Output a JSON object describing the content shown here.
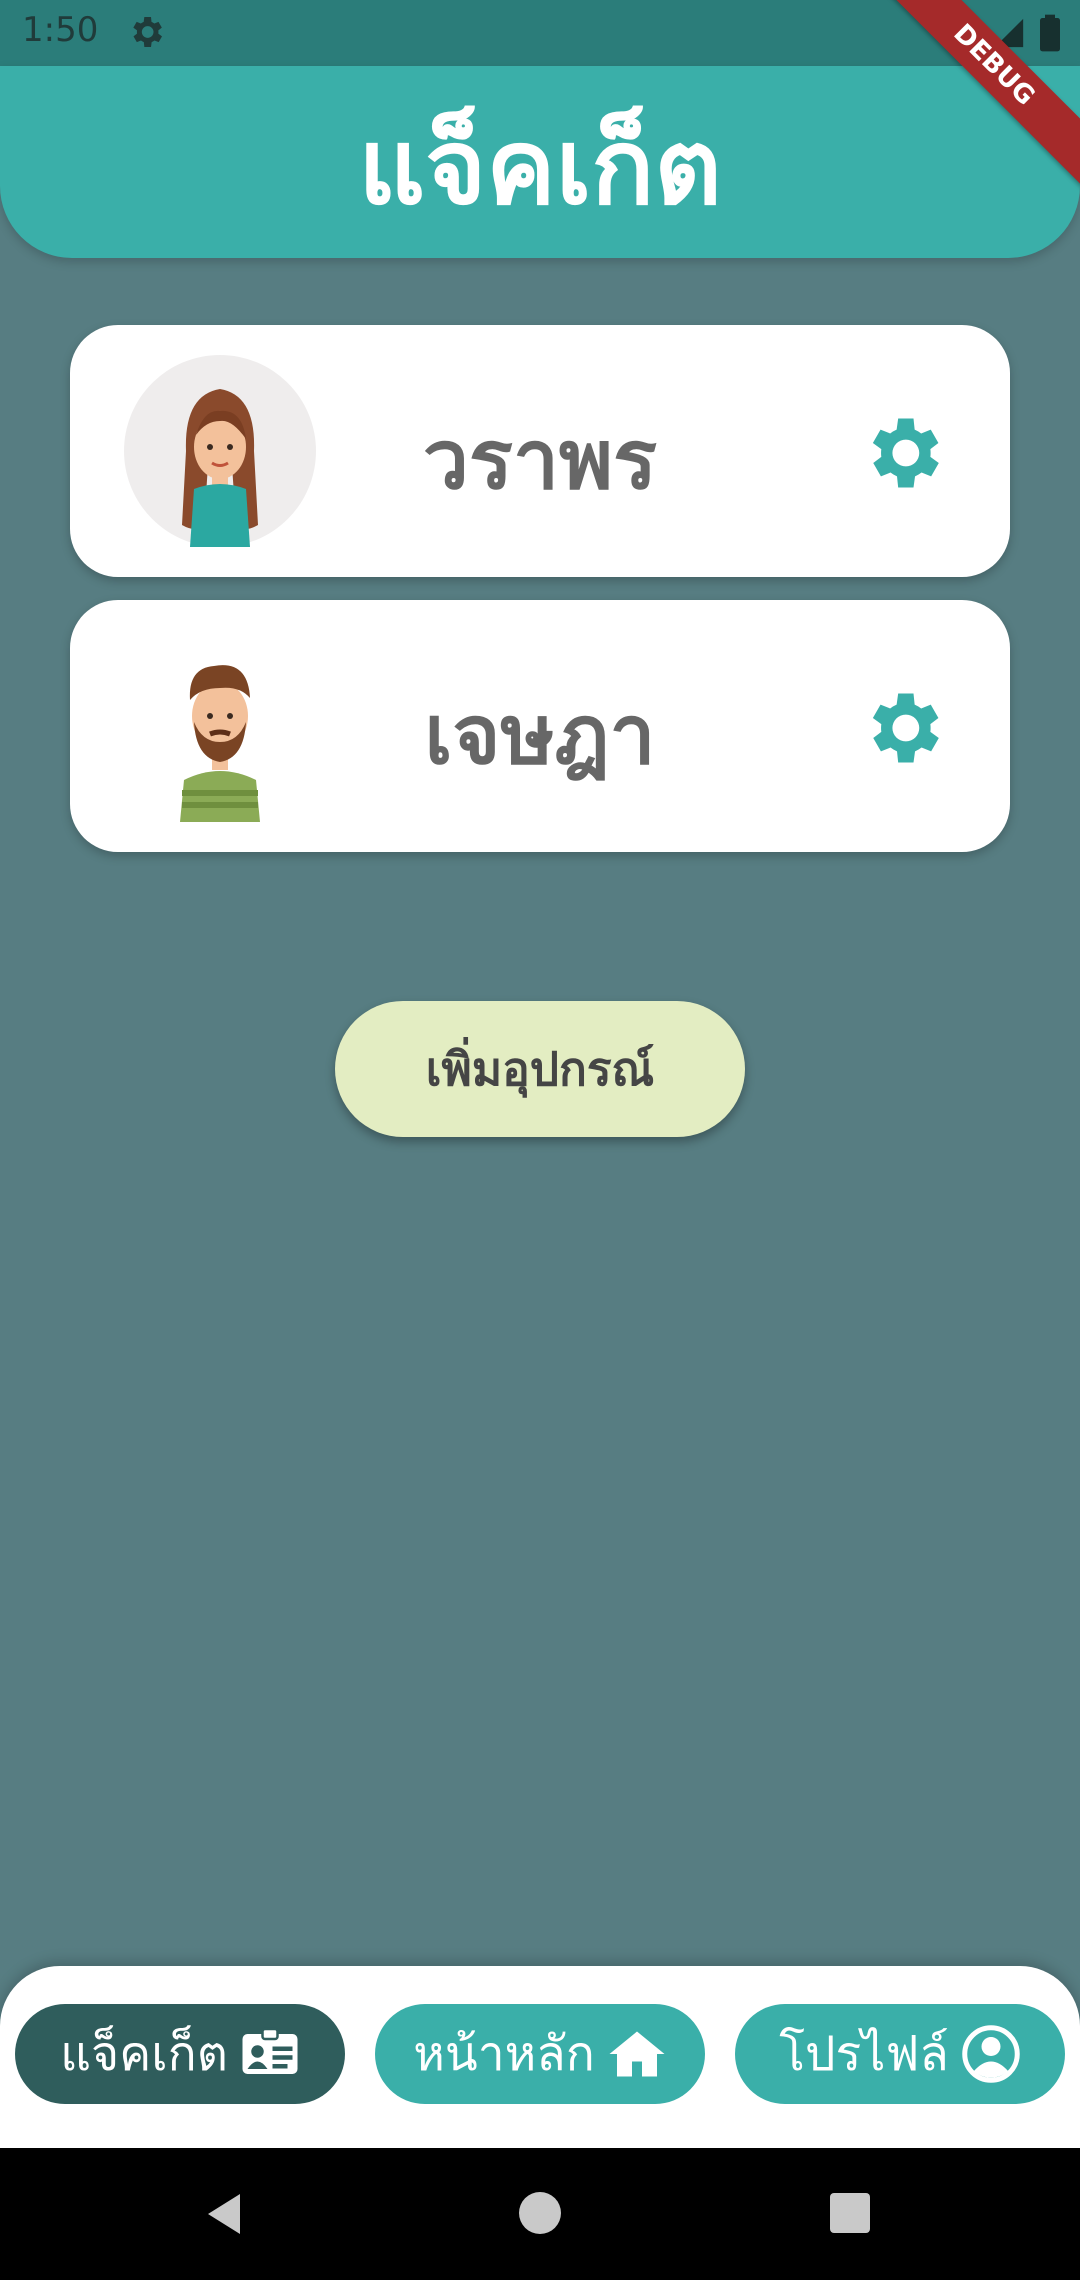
{
  "status_bar": {
    "time": "1:50"
  },
  "debug_banner": "DEBUG",
  "header": {
    "title": "แจ็คเก็ต"
  },
  "cards": [
    {
      "name": "วราพร"
    },
    {
      "name": "เจษฎา"
    }
  ],
  "add_button": {
    "label": "เพิ่มอุปกรณ์"
  },
  "bottom_nav": {
    "jacket": "แจ็คเก็ต",
    "home": "หน้าหลัก",
    "profile": "โปรไฟล์"
  },
  "colors": {
    "teal": "#3aafa9",
    "dark_teal": "#2f5d5c",
    "background": "#577d82",
    "add_button_bg": "#e3edc2",
    "debug_ribbon": "#a52a2a"
  }
}
